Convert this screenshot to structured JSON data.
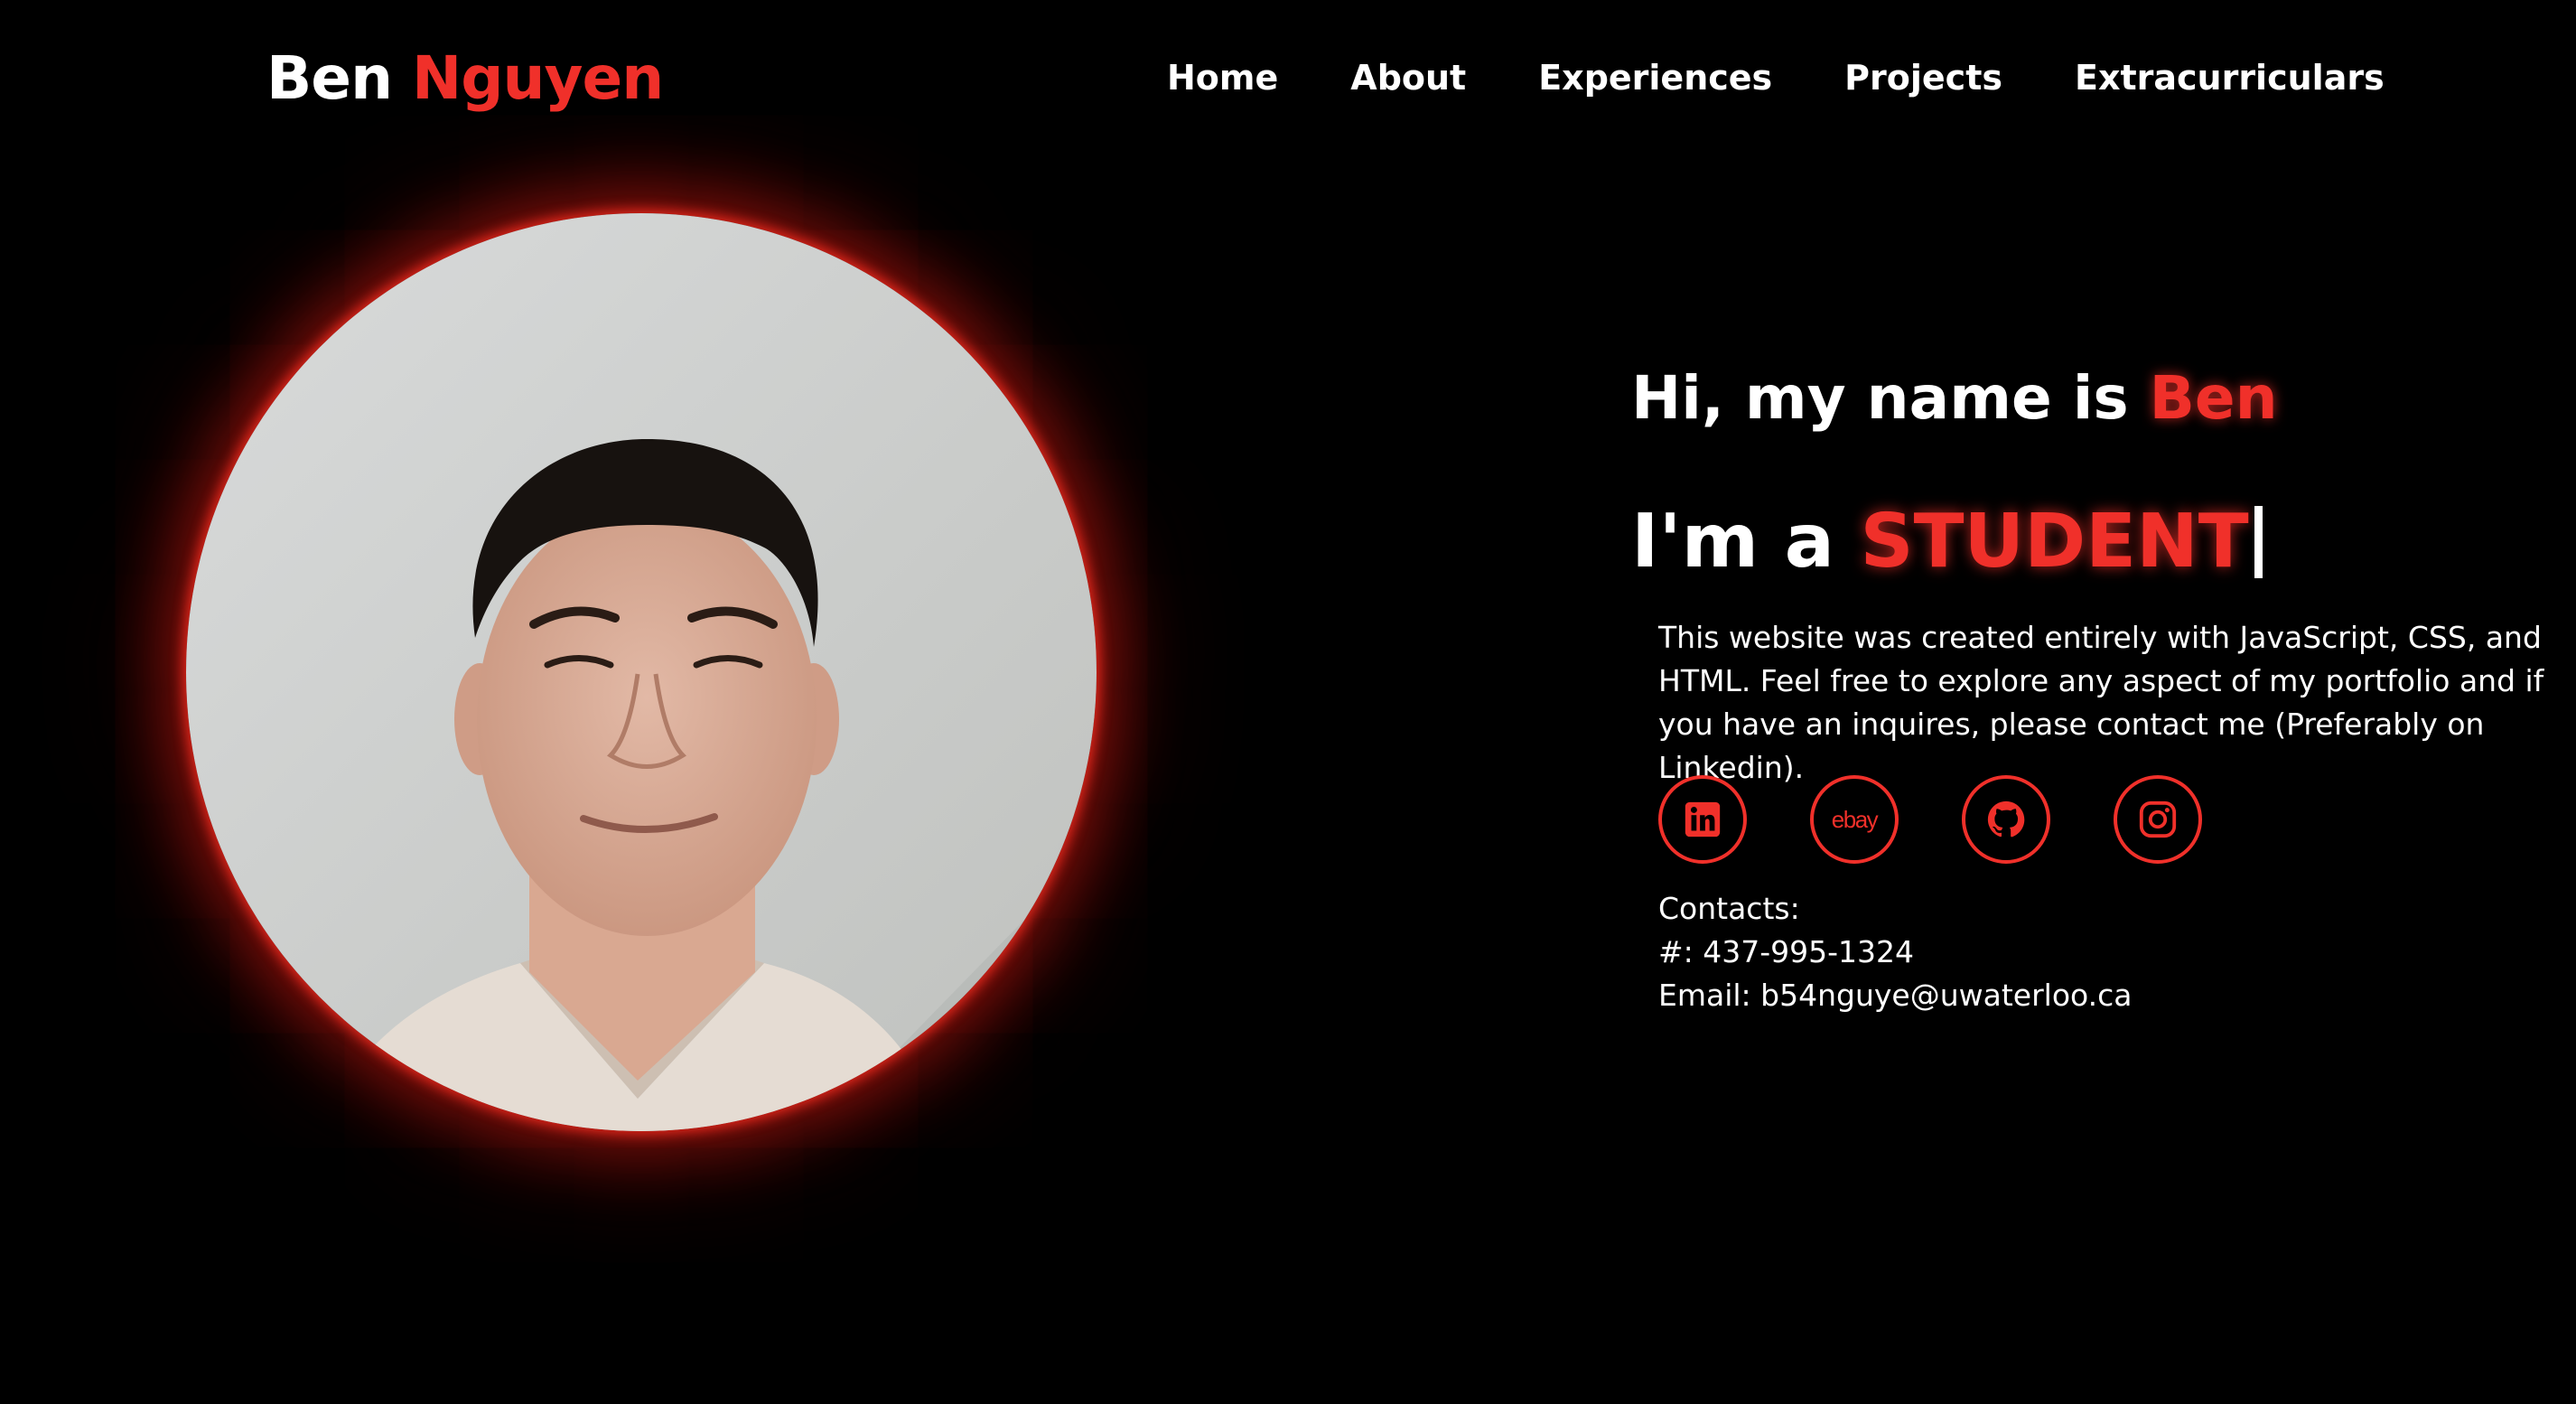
{
  "logo": {
    "first": "Ben",
    "last": "Nguyen"
  },
  "nav": [
    {
      "label": "Home"
    },
    {
      "label": "About"
    },
    {
      "label": "Experiences"
    },
    {
      "label": "Projects"
    },
    {
      "label": "Extracurriculars"
    }
  ],
  "hero": {
    "greeting_prefix": "Hi, my name is",
    "greeting_name": "Ben",
    "role_prefix": "I'm a",
    "role_word": "STUDENT",
    "description": "This website was created entirely with JavaScript, CSS, and HTML. Feel free to explore any aspect of my portfolio and if you have an inquires, please contact me (Preferably on Linkedin)."
  },
  "socials": [
    {
      "name": "linkedin-icon"
    },
    {
      "name": "ebay-icon",
      "text": "ebay"
    },
    {
      "name": "github-icon"
    },
    {
      "name": "instagram-icon"
    }
  ],
  "contacts": {
    "heading": "Contacts:",
    "phone": "#: 437-995-1324",
    "email": "Email: b54nguye@uwaterloo.ca"
  },
  "colors": {
    "accent": "#f0302a",
    "background": "#000000",
    "text": "#ffffff"
  }
}
